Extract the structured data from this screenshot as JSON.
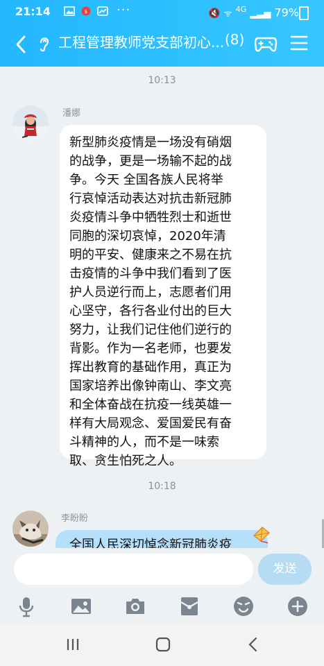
{
  "status": {
    "time": "21:14",
    "dots": "···",
    "signal_text": "4G",
    "battery": "79%"
  },
  "header": {
    "title": "工程管理教师党支部初心...",
    "member_count": "(8)"
  },
  "messages": [
    {
      "timestamp": "10:13",
      "sender": "潘娜",
      "lines": [
        "新型肺炎疫情是一场没有硝烟",
        "的战争，更是一场输不起的战",
        "争。今天 全国各族人民将举",
        "行哀悼活动表达对抗击新冠肺",
        "炎疫情斗争中牺牲烈士和逝世",
        "同胞的深切哀悼，2020年清",
        "明的平安、健康来之不易在抗",
        "击疫情的斗争中我们看到了医",
        "护人员逆行而上，志愿者们用",
        "心坚守，各行各业付出的巨大",
        "努力，让我们记住他们逆行的",
        "背影。作为一名老师，也要发",
        "挥出教育的基础作用，真正为",
        "国家培养出像钟南山、李文亮",
        "和全体奋战在抗疫一线英雄一",
        "样有大局观念、爱国爱民有奋",
        "斗精神的人，而不是一味索",
        "取、贪生怕死之人。"
      ]
    },
    {
      "timestamp": "10:18",
      "sender": "李盼盼",
      "partial_text": "全国人民深切悼念新冠肺炎疫"
    }
  ],
  "input": {
    "placeholder": "",
    "send_label": "发送"
  },
  "toolbar": [
    "microphone-icon",
    "image-icon",
    "camera-icon",
    "red-packet-icon",
    "emoji-icon",
    "plus-icon"
  ],
  "colors": {
    "accent": "#2ab9ff",
    "background": "#eef1f4",
    "bubble_self": "#b6dffb",
    "send_button": "#b6dcf4"
  }
}
